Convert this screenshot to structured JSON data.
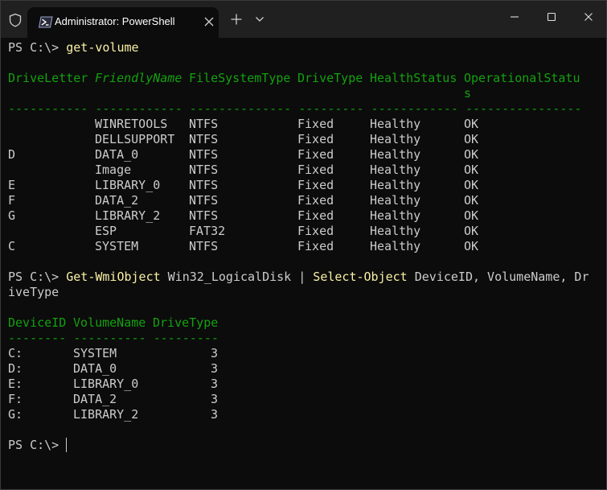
{
  "titlebar": {
    "tab_title": "Administrator: PowerShell"
  },
  "icons": {
    "shield": "shield-icon",
    "powershell": "powershell-icon",
    "tab_close": "close-icon",
    "new_tab": "plus-icon",
    "tab_dropdown": "chevron-down-icon",
    "minimize": "minimize-icon",
    "maximize": "maximize-icon",
    "close": "close-icon"
  },
  "colors": {
    "background": "#0c0c0c",
    "titlebar": "#202020",
    "text": "#cccccc",
    "header_green": "#13a10e",
    "command_yellow": "#f9f1a5"
  },
  "terminal": {
    "prompt": "PS C:\\> ",
    "cmd1": "get-volume",
    "vol_headers": [
      "DriveLetter",
      "FriendlyName",
      "FileSystemType",
      "DriveType",
      "HealthStatus",
      "OperationalStatu"
    ],
    "vol_header_wrap": "s",
    "vol_underline": "----------- ------------ -------------- --------- ------------ ----------------",
    "vol_rows": [
      {
        "drive": "",
        "name": "WINRETOOLS",
        "fs": "NTFS",
        "type": "Fixed",
        "health": "Healthy",
        "op": "OK"
      },
      {
        "drive": "",
        "name": "DELLSUPPORT",
        "fs": "NTFS",
        "type": "Fixed",
        "health": "Healthy",
        "op": "OK"
      },
      {
        "drive": "D",
        "name": "DATA_0",
        "fs": "NTFS",
        "type": "Fixed",
        "health": "Healthy",
        "op": "OK"
      },
      {
        "drive": "",
        "name": "Image",
        "fs": "NTFS",
        "type": "Fixed",
        "health": "Healthy",
        "op": "OK"
      },
      {
        "drive": "E",
        "name": "LIBRARY_0",
        "fs": "NTFS",
        "type": "Fixed",
        "health": "Healthy",
        "op": "OK"
      },
      {
        "drive": "F",
        "name": "DATA_2",
        "fs": "NTFS",
        "type": "Fixed",
        "health": "Healthy",
        "op": "OK"
      },
      {
        "drive": "G",
        "name": "LIBRARY_2",
        "fs": "NTFS",
        "type": "Fixed",
        "health": "Healthy",
        "op": "OK"
      },
      {
        "drive": "",
        "name": "ESP",
        "fs": "FAT32",
        "type": "Fixed",
        "health": "Healthy",
        "op": "OK"
      },
      {
        "drive": "C",
        "name": "SYSTEM",
        "fs": "NTFS",
        "type": "Fixed",
        "health": "Healthy",
        "op": "OK"
      }
    ],
    "cmd2_part1": "Get-WmiObject",
    "cmd2_part2": " Win32_LogicalDisk ",
    "cmd2_pipe": "|",
    "cmd2_part3": " Select-Object",
    "cmd2_part4": " DeviceID, VolumeName, Dr",
    "cmd2_wrap": "iveType",
    "wmi_headers": [
      "DeviceID",
      "VolumeName",
      "DriveType"
    ],
    "wmi_underline": "-------- ---------- ---------",
    "wmi_rows": [
      {
        "id": "C:",
        "name": "SYSTEM",
        "type": "3"
      },
      {
        "id": "D:",
        "name": "DATA_0",
        "type": "3"
      },
      {
        "id": "E:",
        "name": "LIBRARY_0",
        "type": "3"
      },
      {
        "id": "F:",
        "name": "DATA_2",
        "type": "3"
      },
      {
        "id": "G:",
        "name": "LIBRARY_2",
        "type": "3"
      }
    ]
  }
}
